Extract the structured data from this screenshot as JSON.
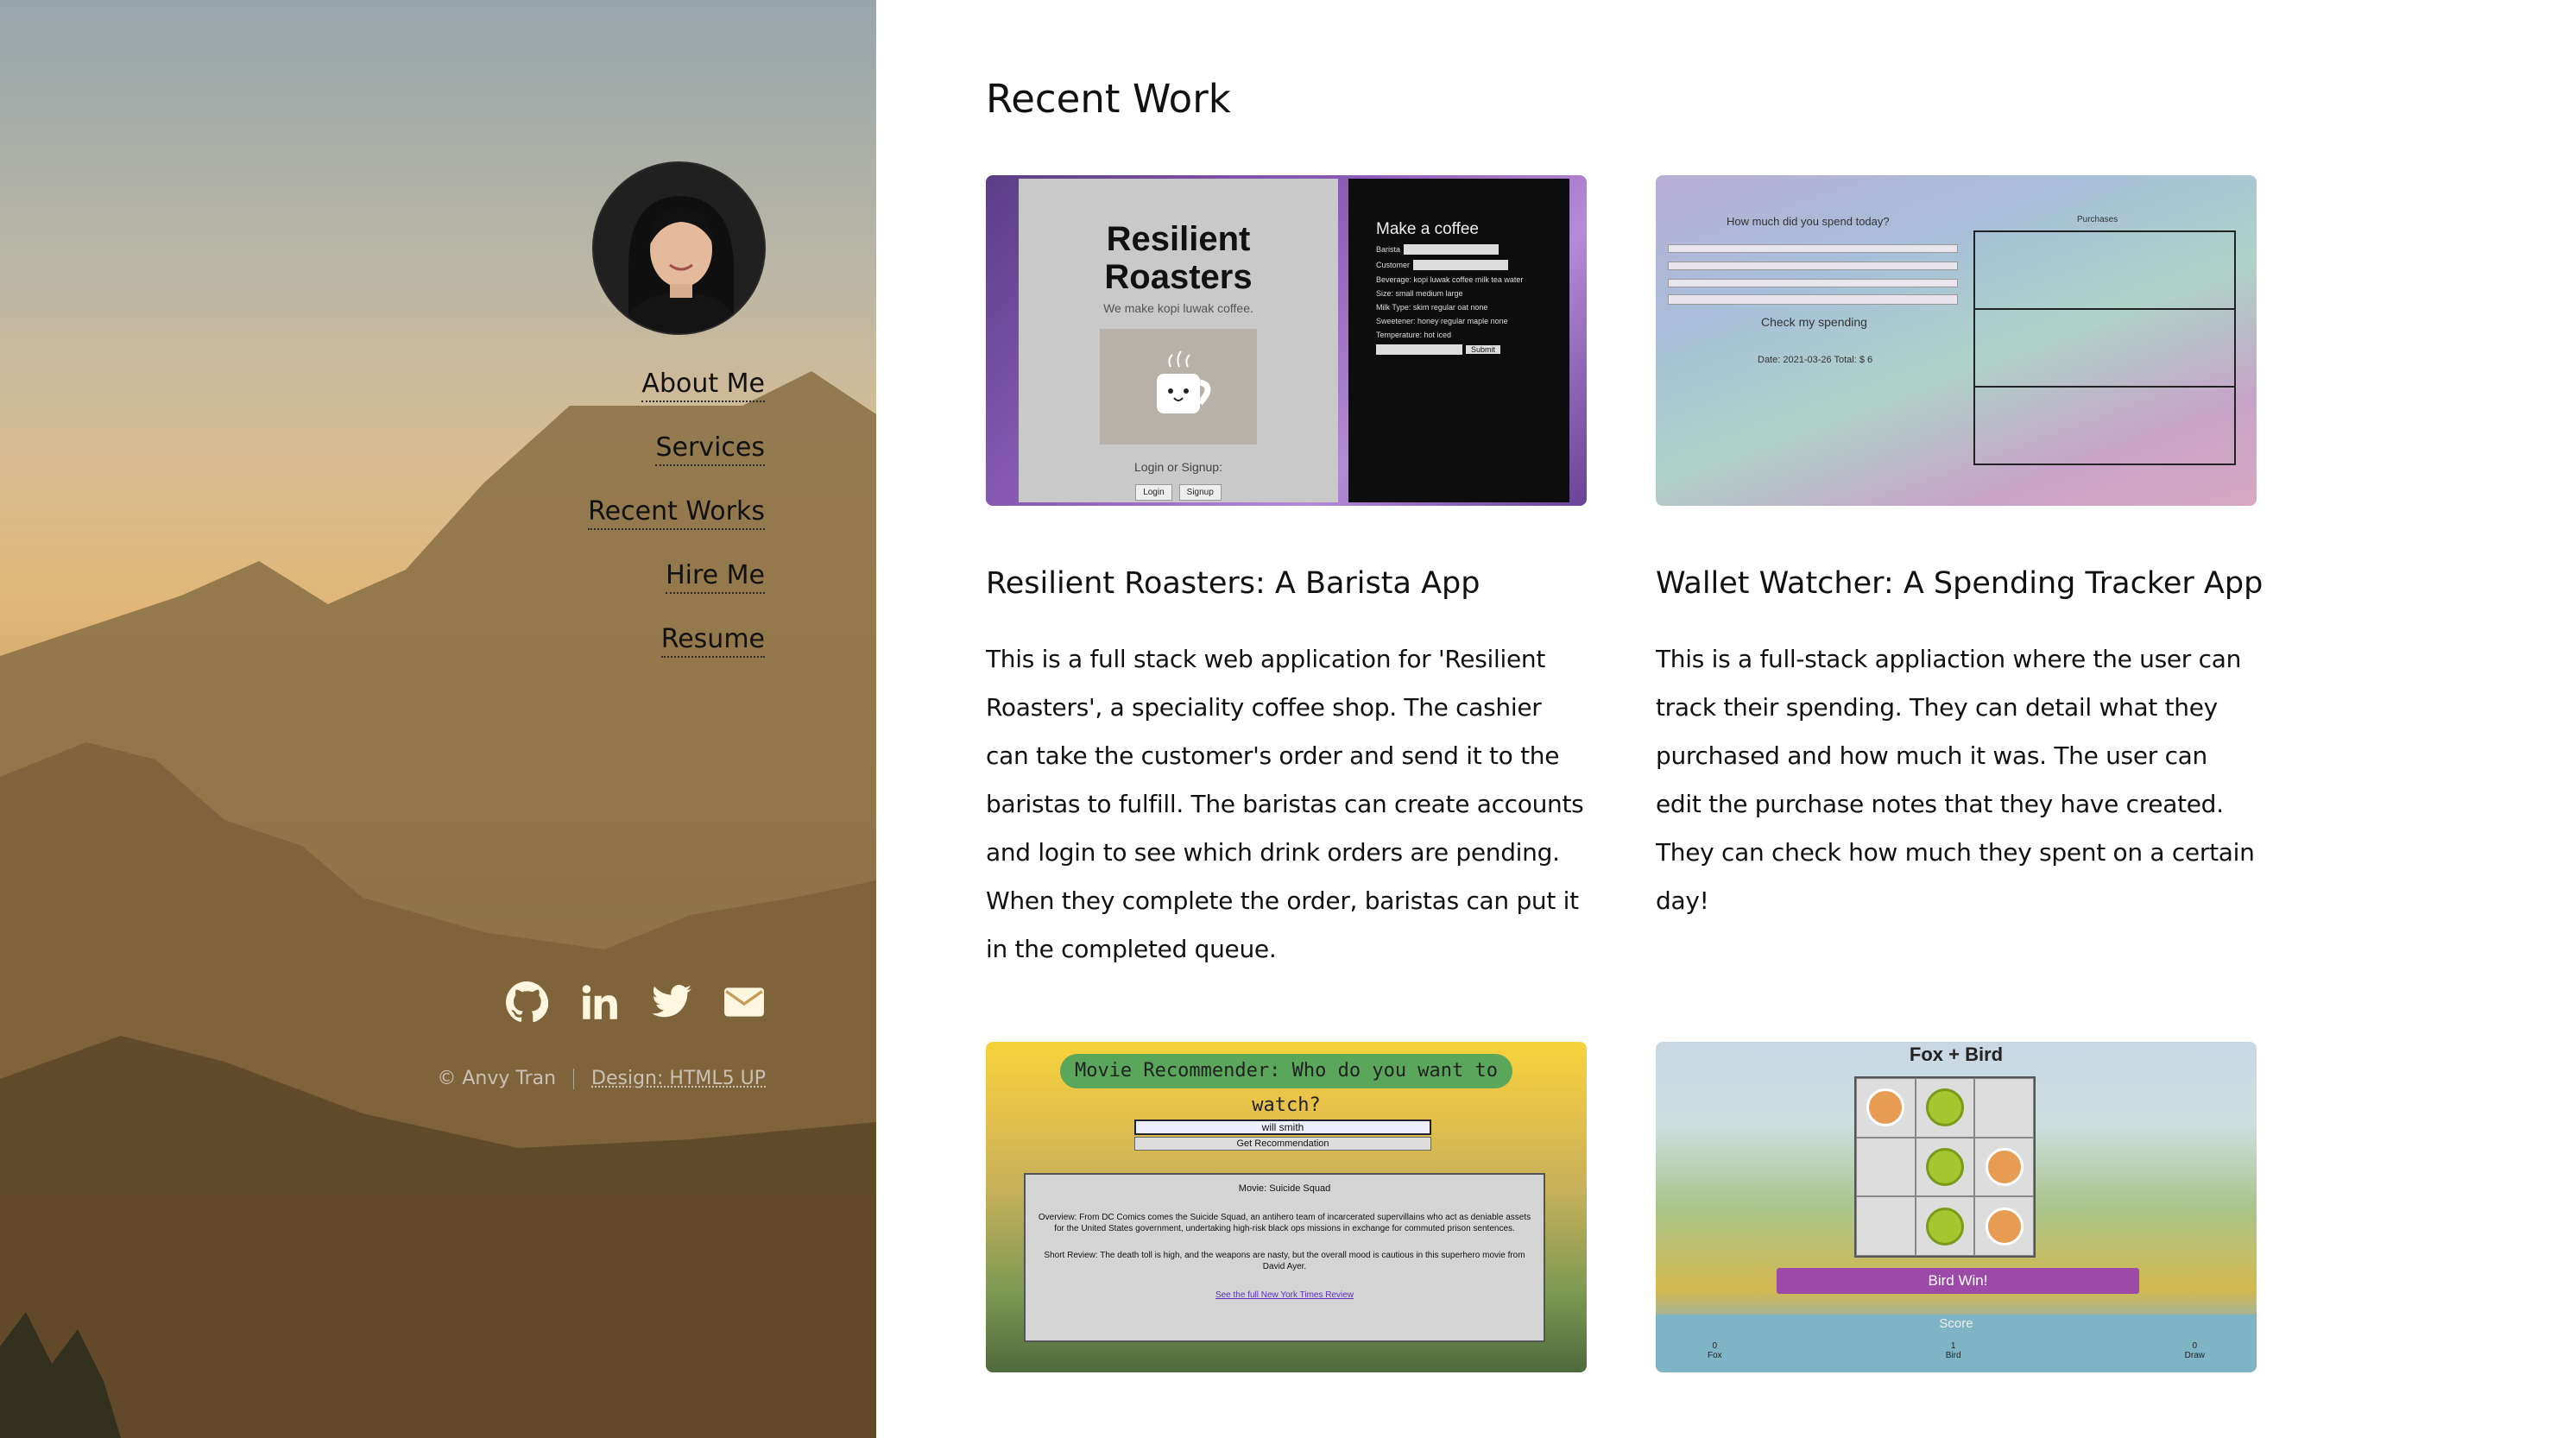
{
  "sidebar": {
    "nav": [
      "About Me",
      "Services",
      "Recent Works",
      "Hire Me",
      "Resume"
    ],
    "social": [
      "github-icon",
      "linkedin-icon",
      "twitter-icon",
      "envelope-icon"
    ],
    "copyright": "© Anvy Tran",
    "design_label": "Design: HTML5 UP"
  },
  "main": {
    "title": "Recent Work",
    "projects": [
      {
        "title": "Resilient Roasters: A Barista App",
        "description": "This is a full stack web application for 'Resilient Roasters', a speciality coffee shop. The cashier can take the customer's order and send it to the baristas to fulfill. The baristas can create accounts and login to see which drink orders are pending. When they complete the order, baristas can put it in the completed queue.",
        "thumb": {
          "heading_line1": "Resilient",
          "heading_line2": "Roasters",
          "tagline": "We make kopi luwak coffee.",
          "login_label": "Login or Signup:",
          "login_btn": "Login",
          "signup_btn": "Signup",
          "form_title": "Make a coffee",
          "form_rows": [
            "Barista",
            "Customer",
            "Beverage: kopi luwak coffee milk tea water",
            "Size: small medium large",
            "Milk Type: skim regular oat none",
            "Sweetener: honey regular maple none",
            "Temperature: hot iced",
            "Submit"
          ]
        }
      },
      {
        "title": "Wallet Watcher: A Spending Tracker App",
        "description": "This is a full-stack appliaction where the user can track their spending. They can detail what they purchased and how much it was. The user can edit the purchase notes that they have created. They can check how much they spent on a certain day!",
        "thumb": {
          "question": "How much did you spend today?",
          "check_label": "Check my spending",
          "date_total": "Date: 2021-03-26 Total: $ 6",
          "purchases_label": "Purchases"
        }
      },
      {
        "title": "Movie Recommender",
        "thumb": {
          "heading": "Movie Recommender: Who do you want to watch?",
          "input_value": "will smith",
          "button_label": "Get Recommendation",
          "movie": "Movie: Suicide Squad",
          "overview": "Overview: From DC Comics comes the Suicide Squad, an antihero team of incarcerated supervillains who act as deniable assets for the United States government, undertaking high-risk black ops missions in exchange for commuted prison sentences.",
          "review": "Short Review: The death toll is high, and the weapons are nasty, but the overall mood is cautious in this superhero movie from David Ayer.",
          "link": "See the full New York Times Review"
        }
      },
      {
        "title": "Fox + Bird",
        "thumb": {
          "heading": "Fox + Bird",
          "result": "Bird Win!",
          "score_label": "Score",
          "scores": [
            {
              "value": "0",
              "label": "Fox"
            },
            {
              "value": "1",
              "label": "Bird"
            },
            {
              "value": "0",
              "label": "Draw"
            }
          ]
        }
      }
    ]
  },
  "colors": {
    "text": "#111111",
    "accent_purple": "#9c4aa8",
    "sidebar_sky": "#98a5ab",
    "sidebar_glow": "#e2b779"
  }
}
